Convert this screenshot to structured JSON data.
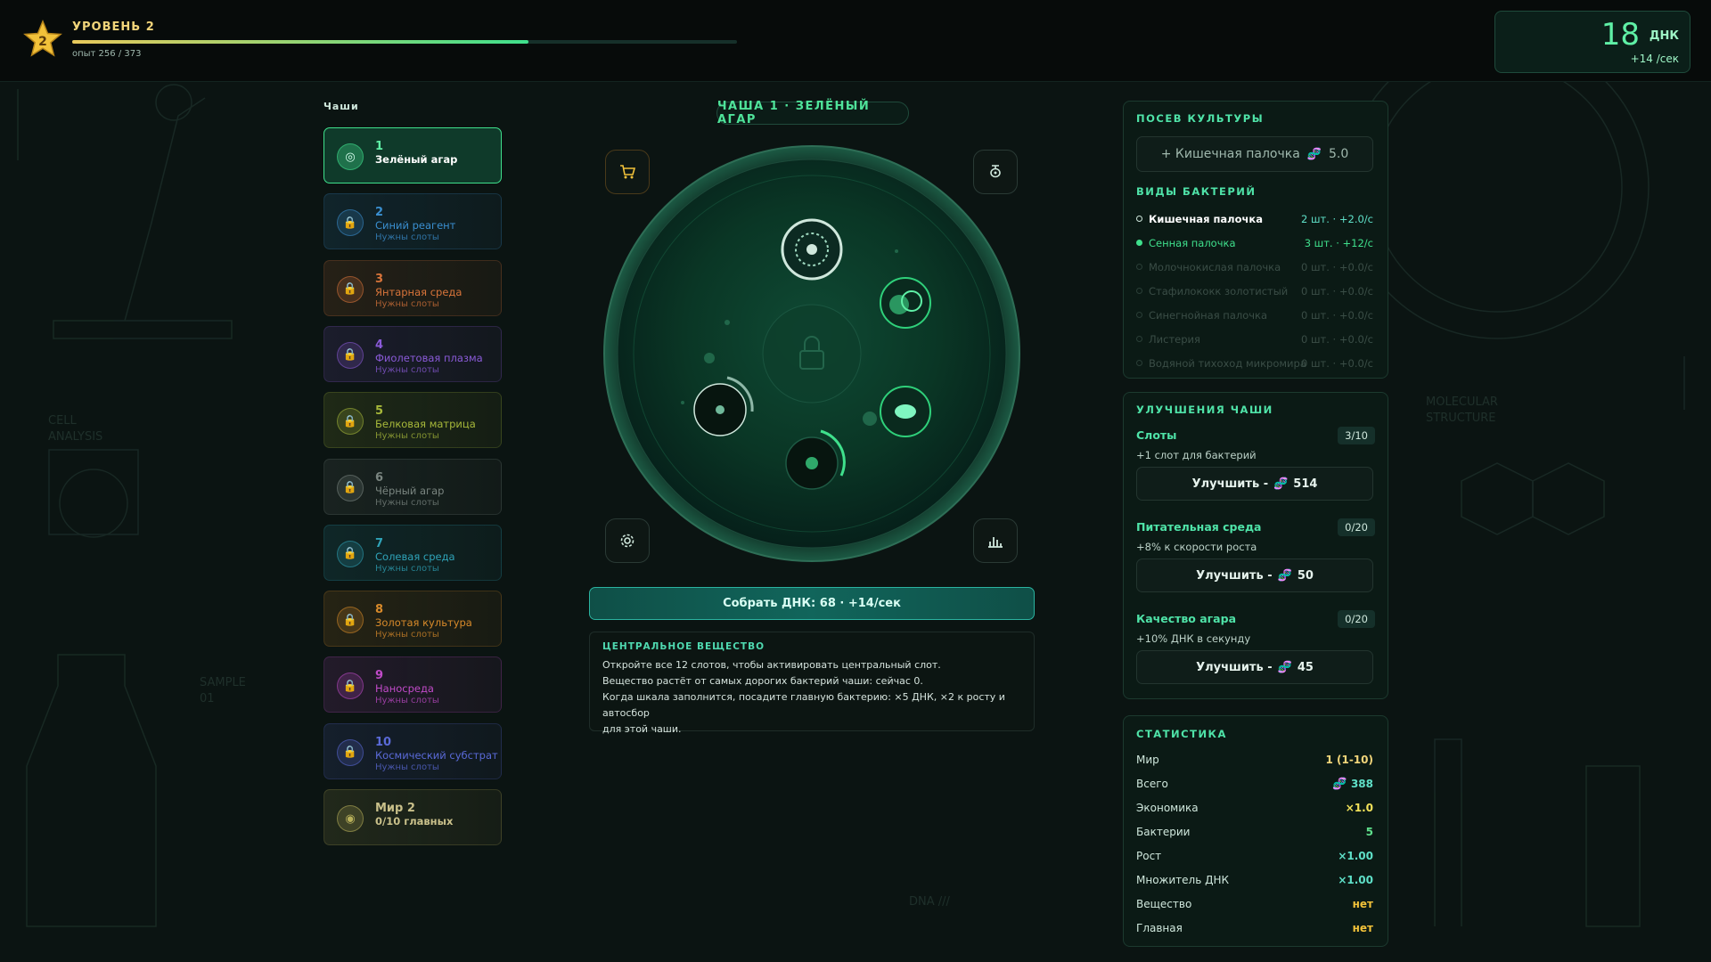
{
  "header": {
    "level_title": "УРОВЕНЬ 2",
    "level_badge": "2",
    "xp_text": "опыт 256 / 373",
    "xp_progress": 0.686,
    "dna_value": "18",
    "dna_unit": "ДНК",
    "dna_rate": "+14 /сек"
  },
  "dishes": {
    "label": "Чаши",
    "items": [
      {
        "num": "1",
        "name": "Зелёный агар",
        "sub": "",
        "color": "#3fe08c",
        "active": true
      },
      {
        "num": "2",
        "name": "Синий реагент",
        "sub": "Нужны слоты",
        "color": "#3a8fd0"
      },
      {
        "num": "3",
        "name": "Янтарная среда",
        "sub": "Нужны слоты",
        "color": "#d8743a"
      },
      {
        "num": "4",
        "name": "Фиолетовая плазма",
        "sub": "Нужны слоты",
        "color": "#8a5ad8"
      },
      {
        "num": "5",
        "name": "Белковая матрица",
        "sub": "Нужны слоты",
        "color": "#a7b83a"
      },
      {
        "num": "6",
        "name": "Чёрный агар",
        "sub": "Нужны слоты",
        "color": "#7a8580"
      },
      {
        "num": "7",
        "name": "Солевая среда",
        "sub": "Нужны слоты",
        "color": "#2fa3b8"
      },
      {
        "num": "8",
        "name": "Золотая культура",
        "sub": "Нужны слоты",
        "color": "#d88a2a"
      },
      {
        "num": "9",
        "name": "Наносреда",
        "sub": "Нужны слоты",
        "color": "#c04ac8"
      },
      {
        "num": "10",
        "name": "Космический субстрат",
        "sub": "Нужны слоты",
        "color": "#5a6ad8"
      },
      {
        "num": "Мир 2",
        "name": "0/10 главных",
        "sub": "",
        "color": "#b8b05a",
        "world": true
      }
    ]
  },
  "center": {
    "title": "ЧАША 1 · ЗЕЛЁНЫЙ АГАР",
    "collect_label": "Собрать ДНК: 68 · +14/сек",
    "central": {
      "title": "ЦЕНТРАЛЬНОЕ ВЕЩЕСТВО",
      "lines": [
        "Откройте все 12 слотов, чтобы активировать центральный слот.",
        "Вещество растёт от самых дорогих бактерий чаши: сейчас 0.",
        "Когда шкала заполнится, посадите главную бактерию: ×5 ДНК, ×2 к росту и автосбор",
        "для этой чаши."
      ]
    },
    "icons": {
      "shop": "cart-icon",
      "bio": "microbe-icon",
      "settings": "gear-icon",
      "stats": "bar-chart-icon",
      "lock": "lock-icon"
    }
  },
  "seed": {
    "title": "ПОСЕВ КУЛЬТУРЫ",
    "button_label": "+ Кишечная палочка",
    "button_cost": "5.0"
  },
  "bacteria": {
    "title": "ВИДЫ БАКТЕРИЙ",
    "items": [
      {
        "name": "Кишечная палочка",
        "value": "2 шт. · +2.0/с",
        "state": "selected"
      },
      {
        "name": "Сенная палочка",
        "value": "3 шт. · +12/с",
        "state": "active"
      },
      {
        "name": "Молочнокислая палочка",
        "value": "0 шт. · +0.0/с",
        "state": "dim"
      },
      {
        "name": "Стафилококк золотистый",
        "value": "0 шт. · +0.0/с",
        "state": "dim"
      },
      {
        "name": "Синегнойная палочка",
        "value": "0 шт. · +0.0/с",
        "state": "dim"
      },
      {
        "name": "Листерия",
        "value": "0 шт. · +0.0/с",
        "state": "dim"
      },
      {
        "name": "Водяной тихоход микромира",
        "value": "0 шт. · +0.0/с",
        "state": "dim"
      }
    ]
  },
  "upgrades": {
    "title": "УЛУЧШЕНИЯ ЧАШИ",
    "items": [
      {
        "name": "Слоты",
        "level": "3/10",
        "desc": "+1 слот для бактерий",
        "btn": "Улучшить -",
        "cost": "514"
      },
      {
        "name": "Питательная среда",
        "level": "0/20",
        "desc": "+8% к скорости роста",
        "btn": "Улучшить -",
        "cost": "50"
      },
      {
        "name": "Качество агара",
        "level": "0/20",
        "desc": "+10% ДНК в секунду",
        "btn": "Улучшить -",
        "cost": "45"
      }
    ]
  },
  "stats": {
    "title": "СТАТИСТИКА",
    "rows": [
      {
        "label": "Мир",
        "value": "1 (1-10)",
        "color": "#f2d57a"
      },
      {
        "label": "Всего",
        "value": "388",
        "color": "#5fe0c8",
        "dna": true
      },
      {
        "label": "Экономика",
        "value": "×1.0",
        "color": "#f2e25a"
      },
      {
        "label": "Бактерии",
        "value": "5",
        "color": "#5fe08c"
      },
      {
        "label": "Рост",
        "value": "×1.00",
        "color": "#5fe0c8"
      },
      {
        "label": "Множитель ДНК",
        "value": "×1.00",
        "color": "#5fe0c8"
      },
      {
        "label": "Вещество",
        "value": "нет",
        "color": "#f2c23a"
      },
      {
        "label": "Главная",
        "value": "нет",
        "color": "#f2c23a"
      }
    ]
  },
  "colors": {
    "accent": "#4fe3a8",
    "dna_glyph": "#d86cff",
    "bg": "#0b1412"
  }
}
